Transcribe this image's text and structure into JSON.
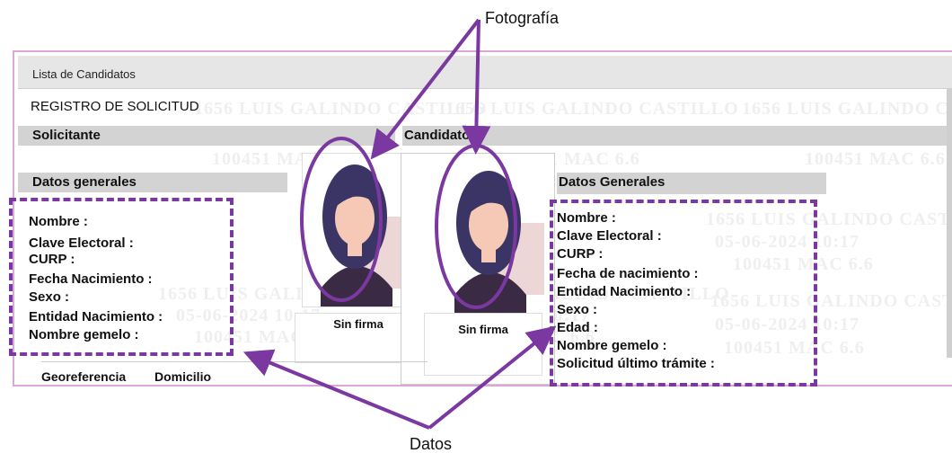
{
  "header": {
    "title": "Lista de Candidatos"
  },
  "watermark": {
    "line1": "100451 MAC 6.6",
    "line2": "1656 LUIS GALINDO CASTILLO",
    "line3": "05-06-2024 10:17"
  },
  "registro": {
    "title": "REGISTRO DE SOLICITUD"
  },
  "solicitante": {
    "section_label": "Solicitante",
    "datos_label": "Datos generales",
    "fields": [
      "Nombre :",
      "Clave Electoral :",
      "CURP :",
      "Fecha Nacimiento :",
      "Sexo :",
      "Entidad Nacimiento :",
      "Nombre gemelo :"
    ],
    "signature": "Sin firma"
  },
  "candidato": {
    "section_label": "Candidato 1",
    "datos_label": "Datos Generales",
    "fields": [
      "Nombre :",
      "Clave Electoral :",
      "CURP :",
      "Fecha de nacimiento :",
      "Entidad Nacimiento :",
      "Sexo :",
      "Edad :",
      "Nombre gemelo :",
      "Solicitud último trámite :"
    ],
    "signature": "Sin firma"
  },
  "bottom_tabs": [
    "Georeferencia",
    "Domicilio"
  ],
  "annotations": {
    "photo": "Fotografía",
    "data": "Datos"
  },
  "colors": {
    "accent": "#7b38a0",
    "frame": "#d9a8d9",
    "section": "#d3d3d3"
  }
}
